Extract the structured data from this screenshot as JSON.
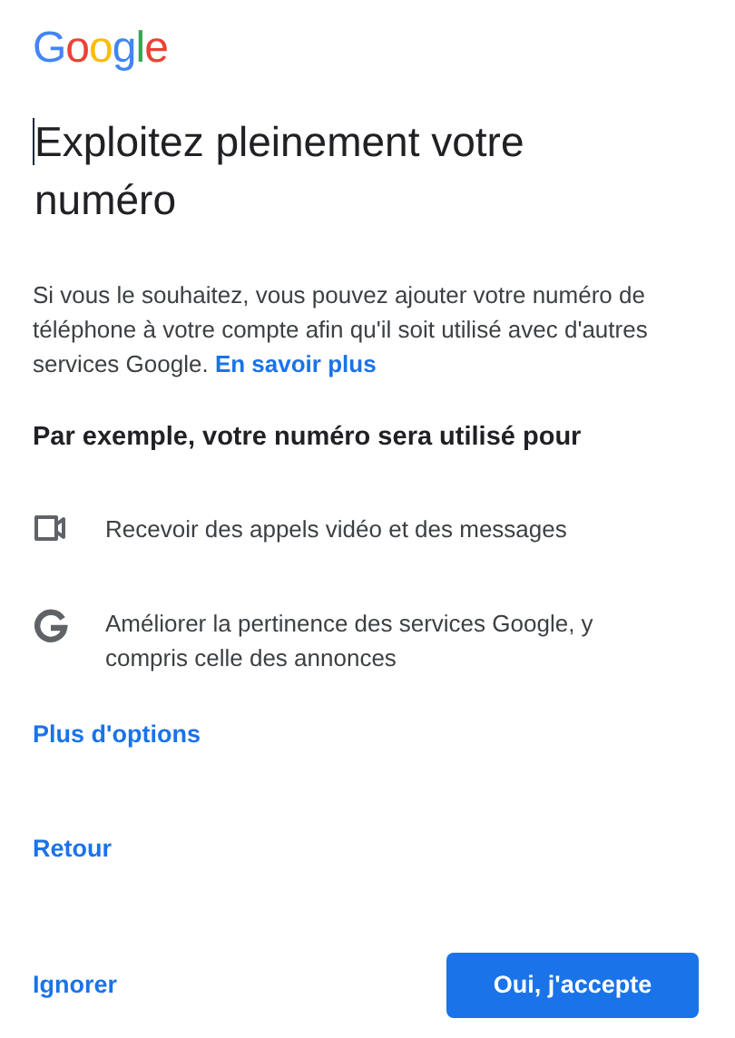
{
  "logo": "Google",
  "title": "Exploitez pleinement votre numéro",
  "description": "Si vous le souhaitez, vous pouvez ajouter votre numéro de téléphone à votre compte afin qu'il soit utilisé avec d'autres services Google.",
  "learn_more_link": "En savoir plus",
  "subheading": "Par exemple, votre numéro sera utilisé pour",
  "uses": [
    {
      "kind": "video",
      "text": "Recevoir des appels vidéo et des messages"
    },
    {
      "kind": "google",
      "text": "Améliorer la pertinence des services Google, y compris celle des annonces"
    }
  ],
  "more_options_link": "Plus d'options",
  "back_link": "Retour",
  "skip_button": "Ignorer",
  "accept_button": "Oui, j'accepte"
}
